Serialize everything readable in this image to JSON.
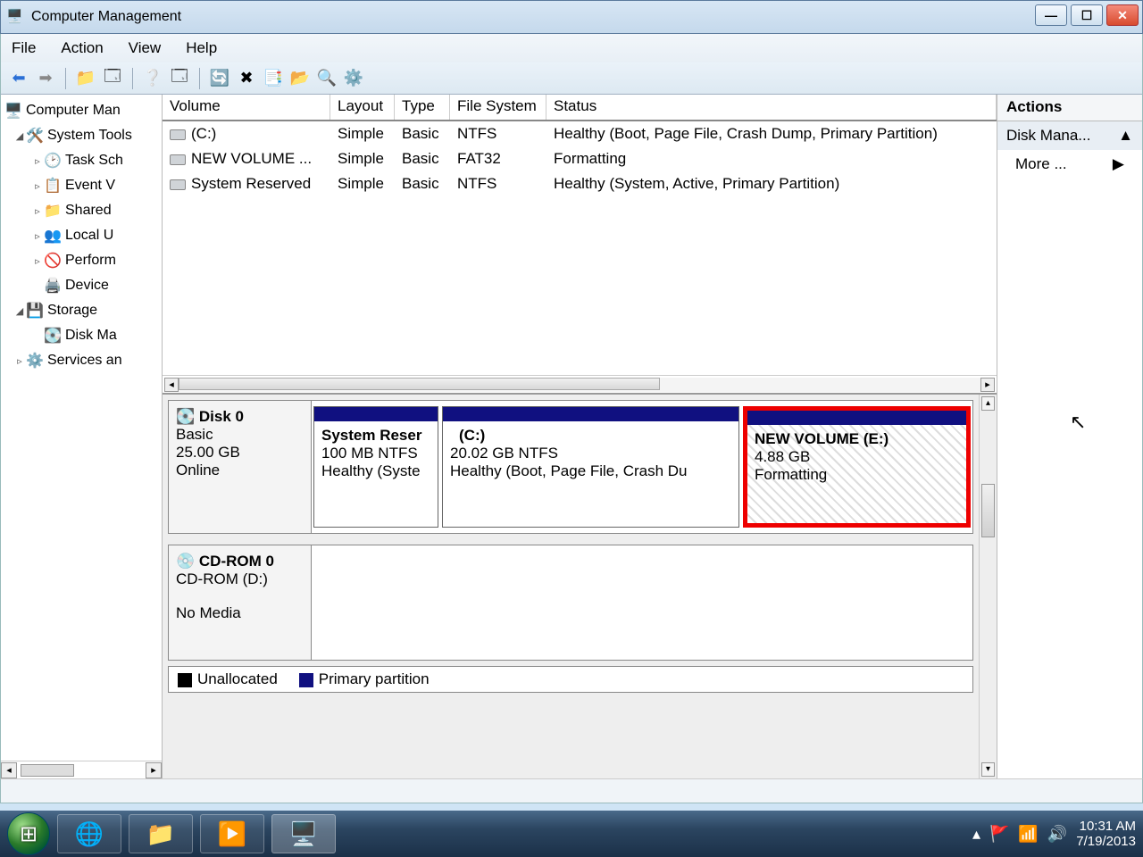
{
  "window": {
    "title": "Computer Management"
  },
  "menu": {
    "file": "File",
    "action": "Action",
    "view": "View",
    "help": "Help"
  },
  "tree": {
    "root": "Computer Man",
    "items": [
      {
        "label": "System Tools",
        "expanded": true,
        "children": [
          {
            "label": "Task Sch"
          },
          {
            "label": "Event V"
          },
          {
            "label": "Shared"
          },
          {
            "label": "Local U"
          },
          {
            "label": "Perform"
          },
          {
            "label": "Device"
          }
        ]
      },
      {
        "label": "Storage",
        "expanded": true,
        "children": [
          {
            "label": "Disk Ma"
          }
        ]
      },
      {
        "label": "Services an",
        "expanded": false,
        "children": []
      }
    ]
  },
  "volumes": {
    "headers": {
      "volume": "Volume",
      "layout": "Layout",
      "type": "Type",
      "fs": "File System",
      "status": "Status"
    },
    "rows": [
      {
        "volume": "(C:)",
        "layout": "Simple",
        "type": "Basic",
        "fs": "NTFS",
        "status": "Healthy (Boot, Page File, Crash Dump, Primary Partition)"
      },
      {
        "volume": "NEW VOLUME ...",
        "layout": "Simple",
        "type": "Basic",
        "fs": "FAT32",
        "status": "Formatting"
      },
      {
        "volume": "System Reserved",
        "layout": "Simple",
        "type": "Basic",
        "fs": "NTFS",
        "status": "Healthy (System, Active, Primary Partition)"
      }
    ]
  },
  "disks": {
    "disk0": {
      "name": "Disk 0",
      "type": "Basic",
      "size": "25.00 GB",
      "state": "Online",
      "parts": [
        {
          "name": "System Reser",
          "line2": "100 MB NTFS",
          "line3": "Healthy (Syste"
        },
        {
          "name": "(C:)",
          "line2": "20.02 GB NTFS",
          "line3": "Healthy (Boot, Page File, Crash Du"
        },
        {
          "name": "NEW VOLUME  (E:)",
          "line2": "4.88 GB",
          "line3": "Formatting"
        }
      ]
    },
    "cdrom": {
      "name": "CD-ROM 0",
      "type": "CD-ROM (D:)",
      "state": "No Media"
    }
  },
  "legend": {
    "unallocated": "Unallocated",
    "primary": "Primary partition"
  },
  "actions": {
    "header": "Actions",
    "item1": "Disk Mana...",
    "more": "More ..."
  },
  "tray": {
    "time": "10:31 AM",
    "date": "7/19/2013"
  }
}
